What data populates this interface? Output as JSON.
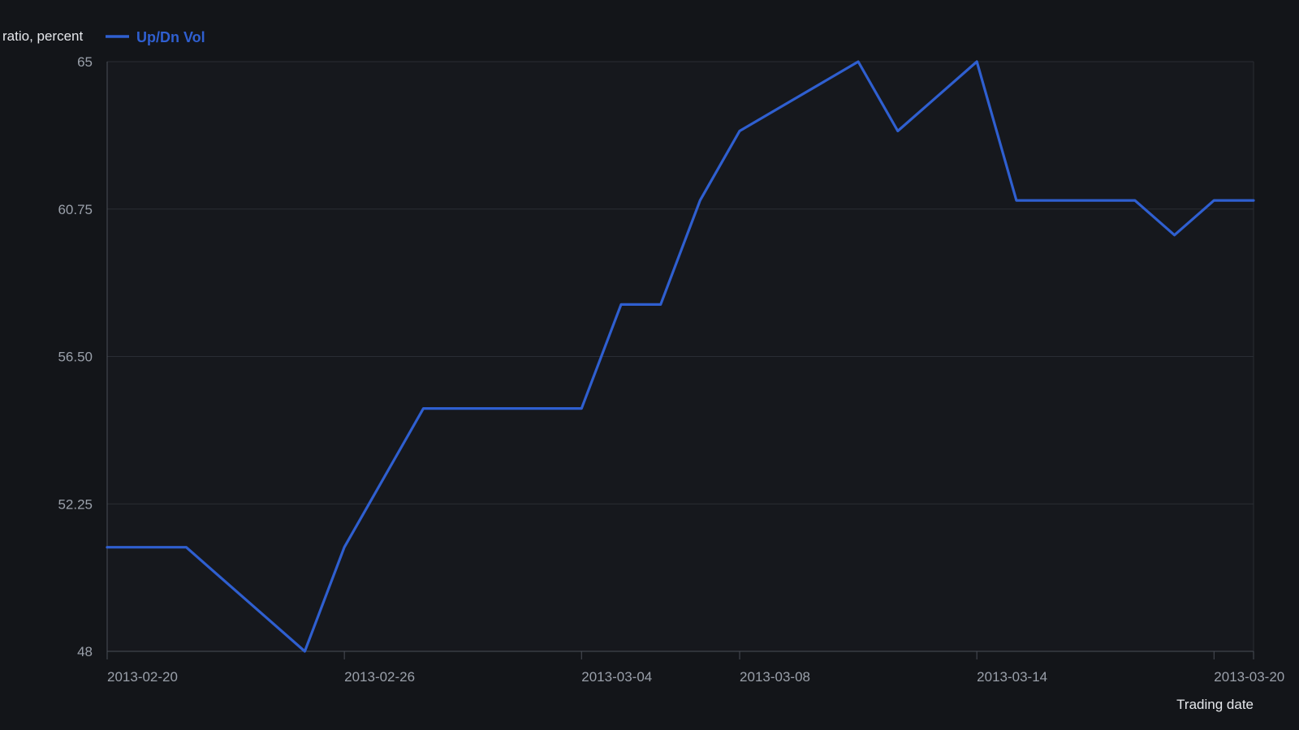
{
  "chart_data": {
    "type": "line",
    "title": "",
    "xlabel": "Trading date",
    "ylabel": "ratio, percent",
    "x_ticks": [
      "2013-02-20",
      "2013-02-26",
      "2013-03-04",
      "2013-03-08",
      "2013-03-14",
      "2013-03-20"
    ],
    "y_ticks": [
      "48",
      "52.25",
      "56.50",
      "60.75",
      "65"
    ],
    "xlim": [
      "2013-02-20",
      "2013-03-21"
    ],
    "ylim": [
      48,
      65
    ],
    "grid": true,
    "legend_position": "top-left",
    "colors": {
      "background": "#131519",
      "plot_background": "#16181d",
      "grid": "#2a2d34",
      "axis": "#4a4e57",
      "series": "#2f5fd0",
      "tick_text": "#9aa0aa",
      "title_text": "#e6e8ec"
    },
    "series": [
      {
        "name": "Up/Dn Vol",
        "points": [
          {
            "x": "2013-02-20",
            "y": 51.0
          },
          {
            "x": "2013-02-22",
            "y": 51.0
          },
          {
            "x": "2013-02-25",
            "y": 48.0
          },
          {
            "x": "2013-02-26",
            "y": 51.0
          },
          {
            "x": "2013-02-28",
            "y": 55.0
          },
          {
            "x": "2013-03-04",
            "y": 55.0
          },
          {
            "x": "2013-03-05",
            "y": 58.0
          },
          {
            "x": "2013-03-06",
            "y": 58.0
          },
          {
            "x": "2013-03-07",
            "y": 61.0
          },
          {
            "x": "2013-03-08",
            "y": 63.0
          },
          {
            "x": "2013-03-11",
            "y": 65.0
          },
          {
            "x": "2013-03-12",
            "y": 63.0
          },
          {
            "x": "2013-03-14",
            "y": 65.0
          },
          {
            "x": "2013-03-15",
            "y": 61.0
          },
          {
            "x": "2013-03-18",
            "y": 61.0
          },
          {
            "x": "2013-03-19",
            "y": 60.0
          },
          {
            "x": "2013-03-20",
            "y": 61.0
          },
          {
            "x": "2013-03-21",
            "y": 61.0
          }
        ]
      }
    ]
  }
}
